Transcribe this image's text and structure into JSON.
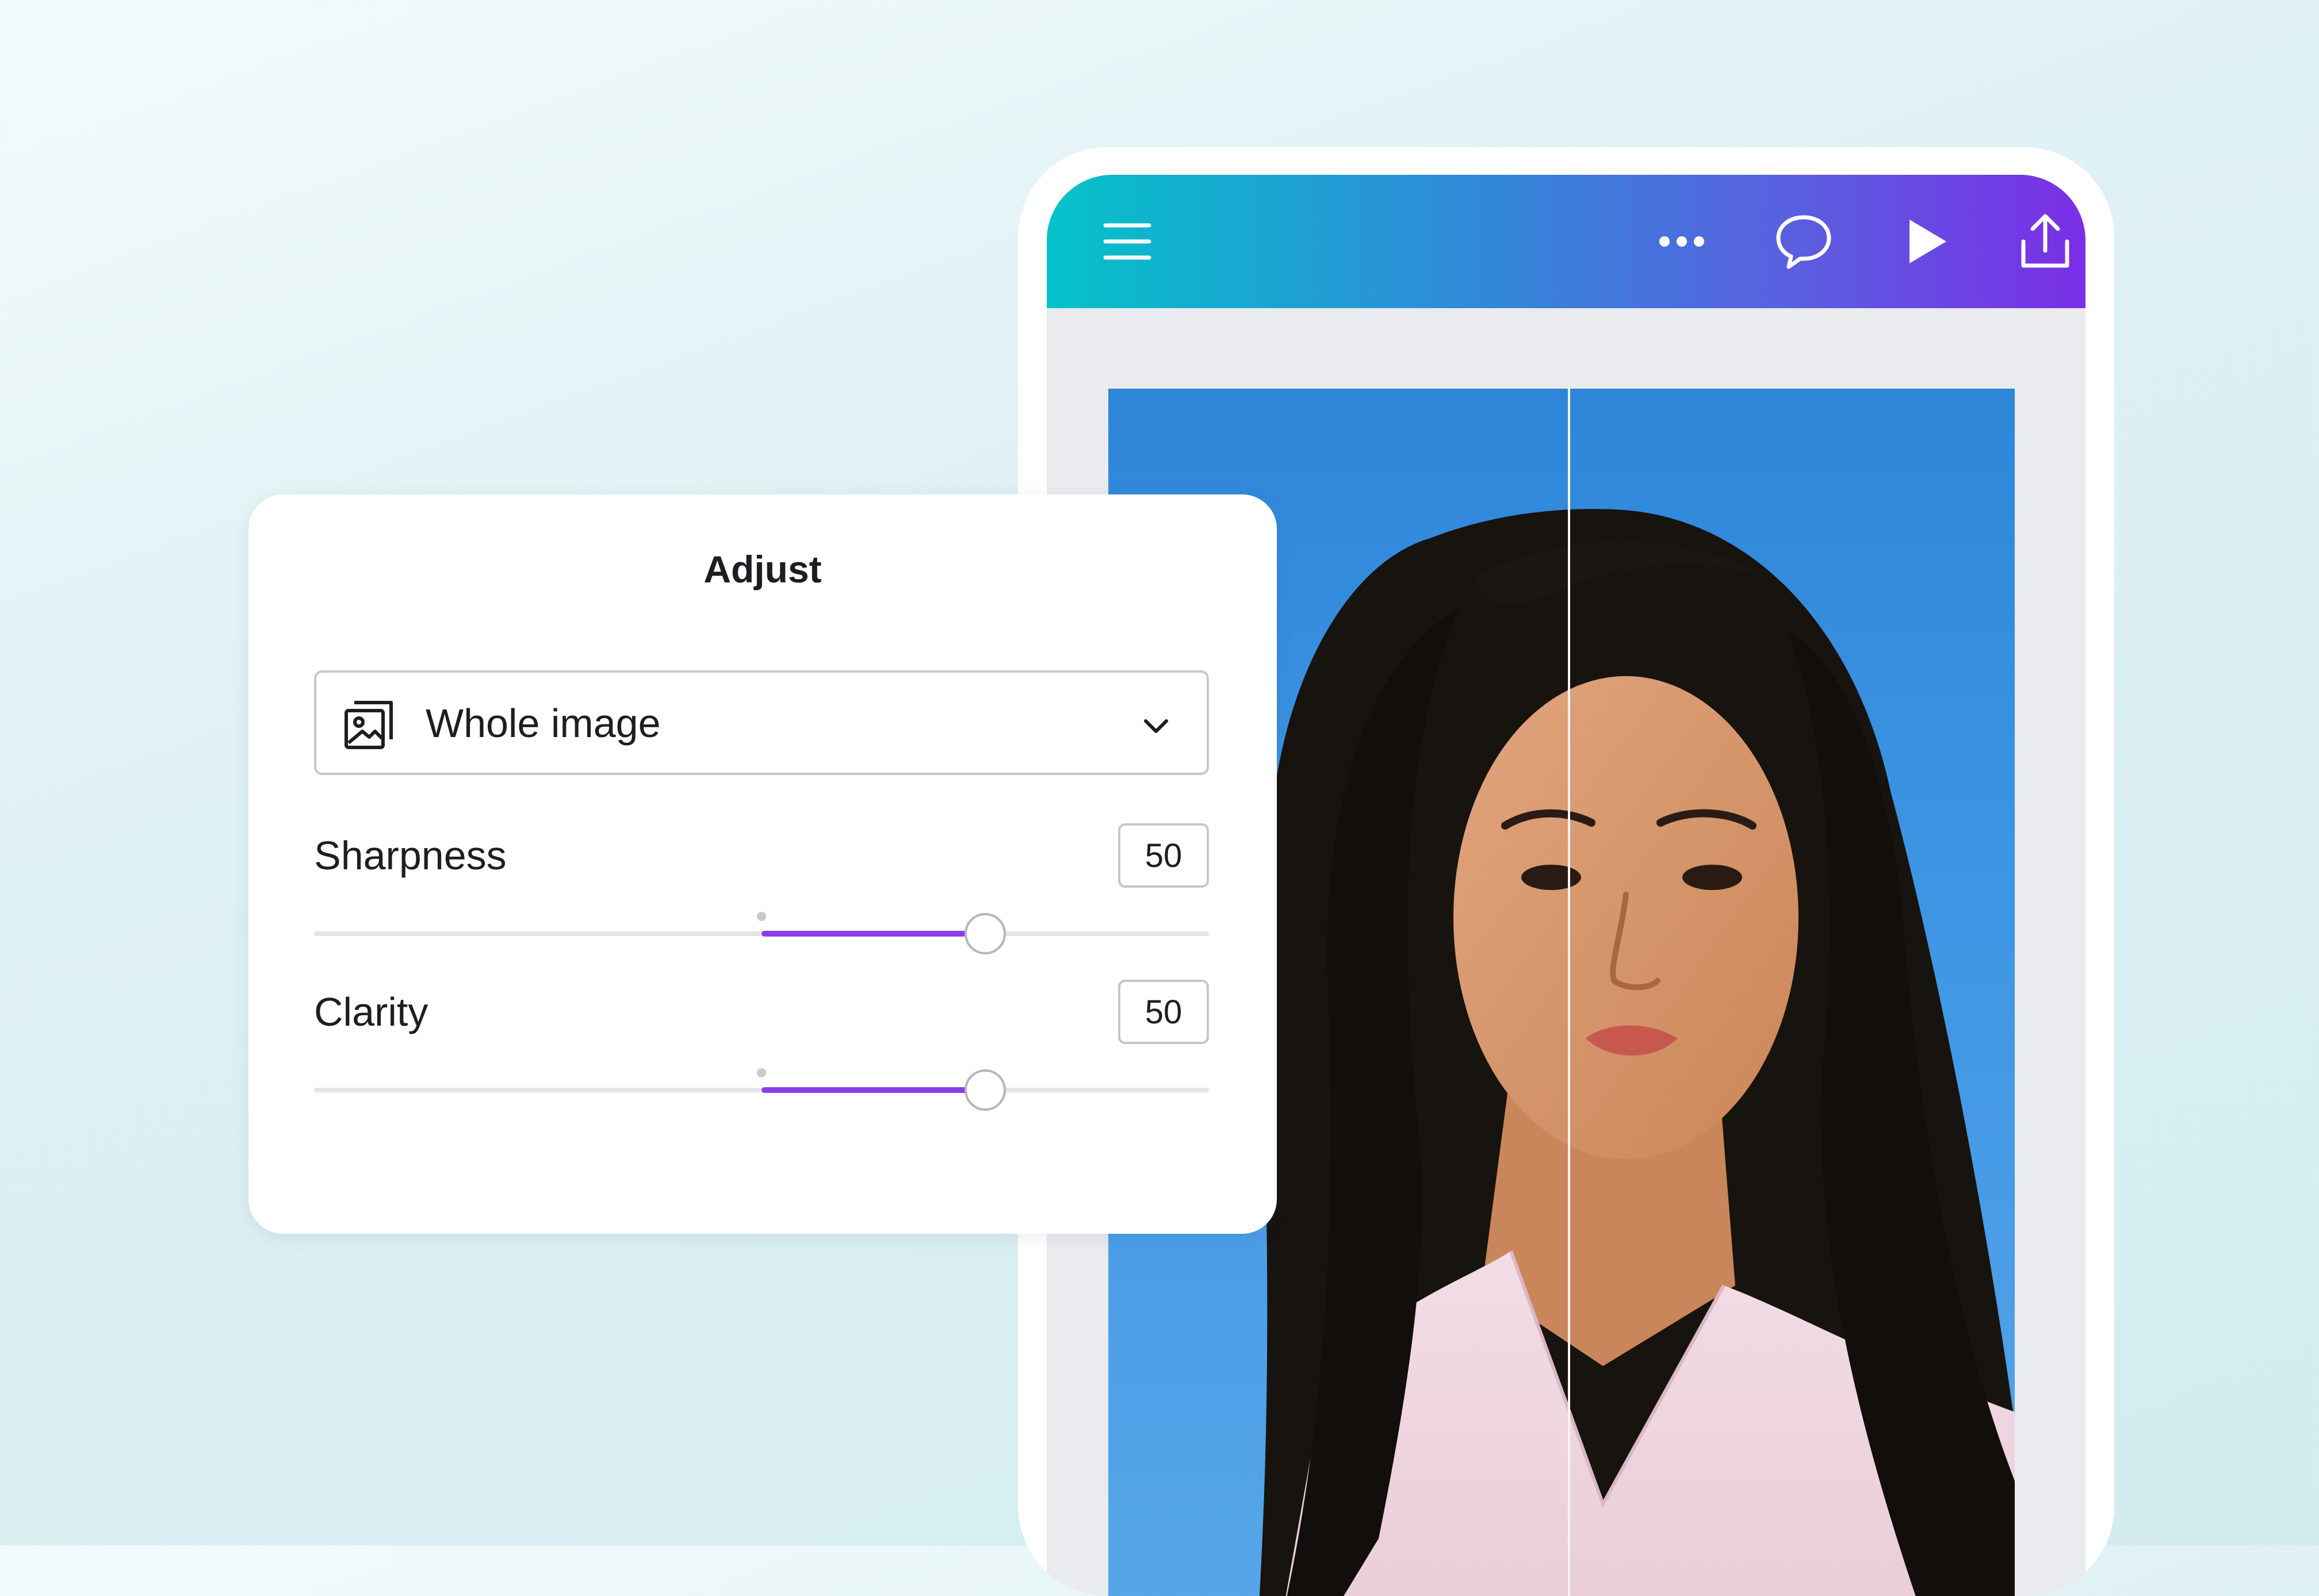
{
  "topbar": {
    "menu_icon": "hamburger-menu-icon",
    "more_icon": "more-dots-icon",
    "comment_icon": "comment-bubble-icon",
    "play_icon": "play-icon",
    "share_icon": "share-upload-icon",
    "gradient": [
      "#05c2c9",
      "#2f8bd8",
      "#7a2ee6"
    ]
  },
  "adjust_panel": {
    "title": "Adjust",
    "target_select": {
      "value": "Whole image",
      "icon": "image-icon"
    },
    "sliders": [
      {
        "label": "Sharpness",
        "value": "50",
        "min": -100,
        "max": 100
      },
      {
        "label": "Clarity",
        "value": "50",
        "min": -100,
        "max": 100
      }
    ],
    "accent_color": "#8b3dea"
  },
  "photo": {
    "description_icon": "portrait-photo",
    "compare_split": true
  }
}
